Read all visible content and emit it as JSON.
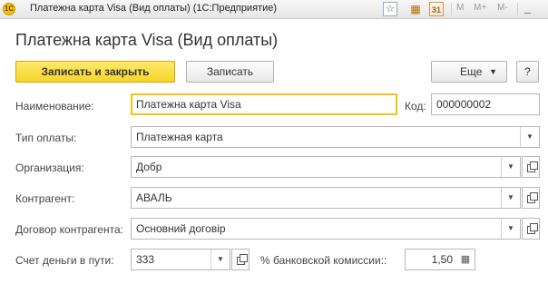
{
  "window": {
    "title": "Платежна карта Visa (Вид оплаты)  (1С:Предприятие)",
    "app_logo_text": "1С",
    "toolbar_buttons": [
      "M",
      "M+",
      "M-"
    ]
  },
  "form": {
    "title": "Платежна карта Visa (Вид оплаты)"
  },
  "command_bar": {
    "write_close_label": "Записать и закрыть",
    "write_label": "Записать",
    "more_label": "Еще",
    "help_label": "?"
  },
  "fields": {
    "name": {
      "label": "Наименование:",
      "value": "Платежна карта Visa"
    },
    "code": {
      "label": "Код:",
      "value": "000000002"
    },
    "payment_type": {
      "label": "Тип оплаты:",
      "value": "Платежная карта"
    },
    "organization": {
      "label": "Организация:",
      "value": "Добр"
    },
    "counterparty": {
      "label": "Контрагент:",
      "value": "АВАЛЬ"
    },
    "contract": {
      "label": "Договор контрагента:",
      "value": "Основний договір"
    },
    "transit_account": {
      "label": "Счет деньги в пути:",
      "value": "333"
    },
    "bank_commission": {
      "label": "% банковской комиссии::",
      "value": "1,50"
    }
  },
  "icons": {
    "favorite": "star-icon",
    "calculator": "calculator-icon",
    "calendar": "calendar-icon",
    "dropdown": "chevron-down-icon",
    "open": "open-form-icon"
  }
}
